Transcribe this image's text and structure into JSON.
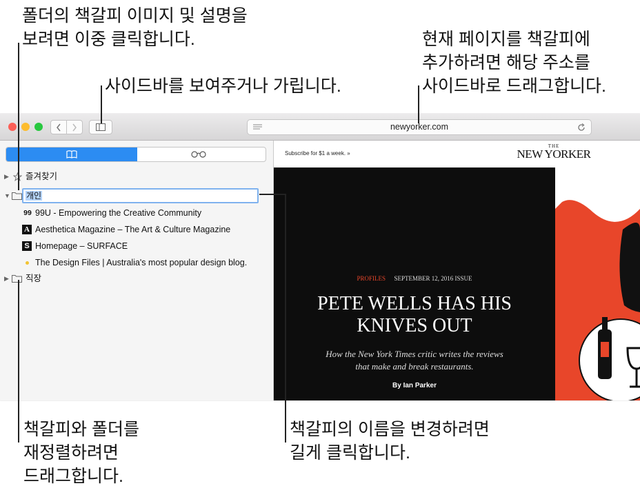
{
  "callouts": {
    "folder_dblclick": "폴더의 책갈피 이미지 및 설명을\n보려면 이중 클릭합니다.",
    "sidebar_toggle": "사이드바를 보여주거나 가립니다.",
    "add_current_page": "현재 페이지를 책갈피에\n추가하려면 해당 주소를\n사이드바로 드래그합니다.",
    "reorder": "책갈피와 폴더를\n재정렬하려면\n드래그합니다.",
    "rename": "책갈피의 이름을 변경하려면\n길게 클릭합니다."
  },
  "toolbar": {
    "url": "newyorker.com",
    "back_icon": "chevron-left-icon",
    "forward_icon": "chevron-right-icon",
    "sidebar_icon": "sidebar-icon",
    "reader_icon": "reader-lines-icon",
    "reload_icon": "reload-icon"
  },
  "sidebar": {
    "tabs": [
      {
        "icon": "book-icon",
        "selected": true
      },
      {
        "icon": "glasses-icon",
        "selected": false
      }
    ],
    "favorites_label": "즐겨찾기",
    "editing_folder_value": "개인",
    "bookmarks": [
      {
        "favicon": "99",
        "label": "99U - Empowering the Creative Community"
      },
      {
        "favicon": "A",
        "label": "Aesthetica Magazine – The Art & Culture Magazine"
      },
      {
        "favicon": "S",
        "label": "Homepage – SURFACE"
      },
      {
        "favicon": "",
        "label": "The Design Files | Australia's most popular design blog."
      }
    ],
    "work_folder_label": "직장"
  },
  "web": {
    "subscribe": "Subscribe for $1 a week. »",
    "logo_the": "THE",
    "logo_main": "NEW YORKER",
    "category": "PROFILES",
    "issue": "SEPTEMBER 12, 2016 ISSUE",
    "headline_1": "PETE WELLS HAS HIS",
    "headline_2": "KNIVES OUT",
    "dek_1": "How the New York Times critic writes the reviews",
    "dek_2": "that make and break restaurants.",
    "byline": "By Ian Parker"
  },
  "colors": {
    "accent": "#2c8cf2",
    "close": "#fc5f57",
    "minimize": "#fdbc2e",
    "zoom": "#28c840",
    "hero_bg": "#0d0d0d",
    "art_red": "#e8462a"
  }
}
